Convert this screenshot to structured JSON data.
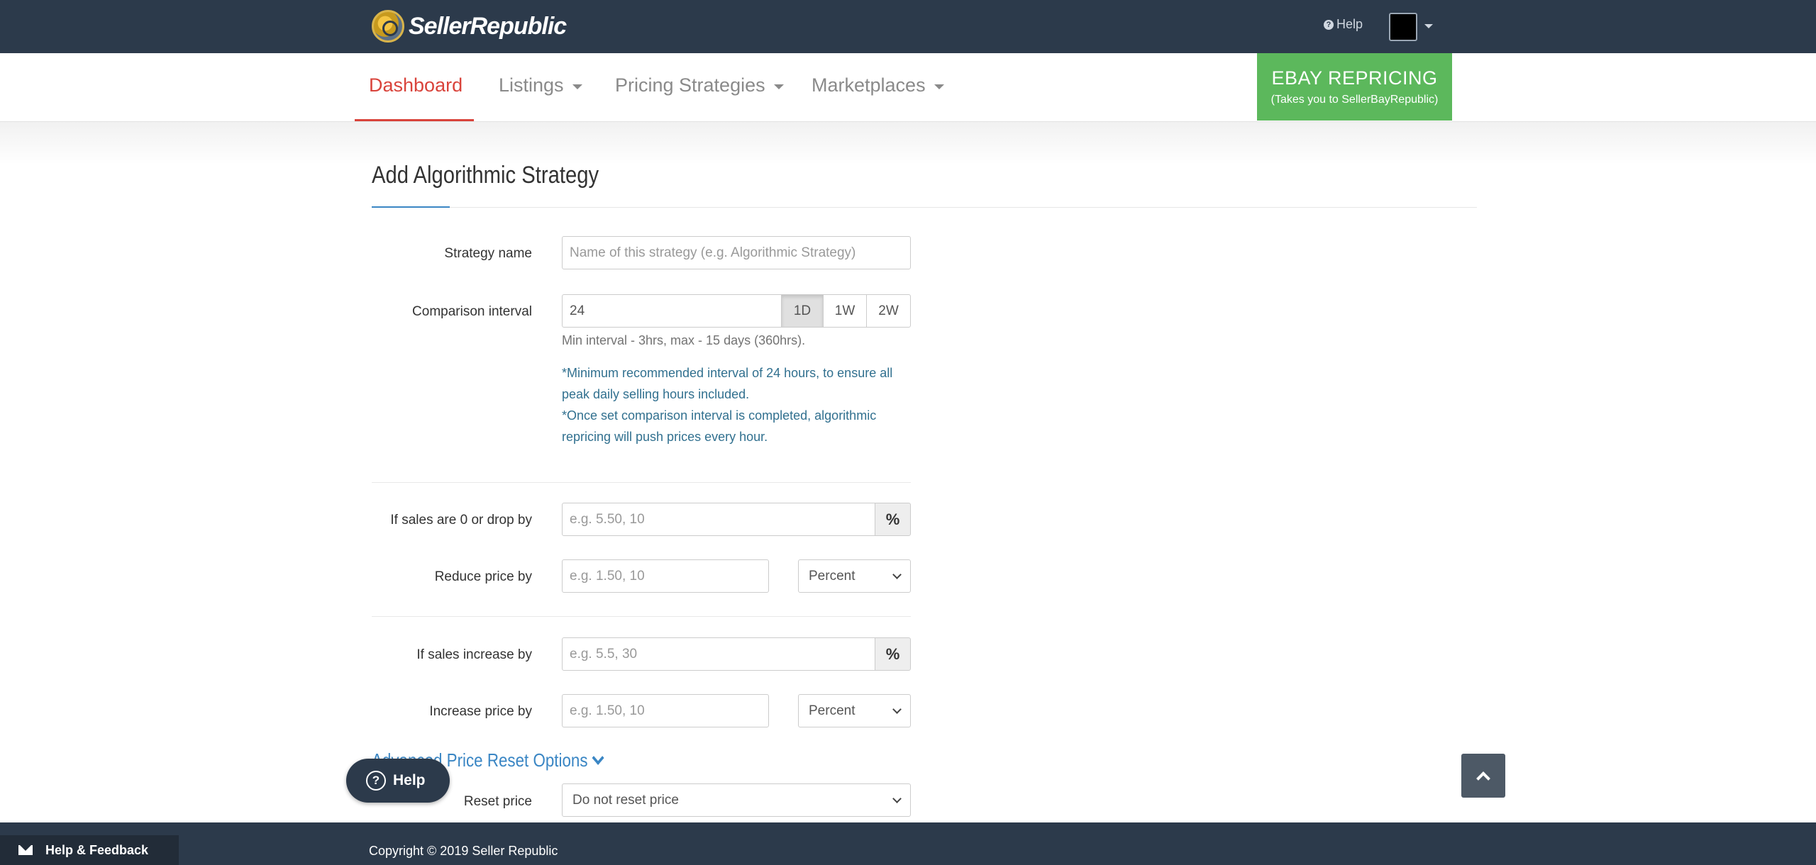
{
  "brand": {
    "name": "SellerRepublic"
  },
  "topbar": {
    "help_label": "Help"
  },
  "nav": {
    "items": [
      {
        "label": "Dashboard"
      },
      {
        "label": "Listings"
      },
      {
        "label": "Pricing Strategies"
      },
      {
        "label": "Marketplaces"
      }
    ],
    "ebay_button": {
      "title": "EBAY REPRICING",
      "subtitle": "(Takes you to SellerBayRepublic)"
    }
  },
  "page": {
    "title": "Add Algorithmic Strategy"
  },
  "form": {
    "strategy_name": {
      "label": "Strategy name",
      "placeholder": "Name of this strategy (e.g. Algorithmic Strategy)"
    },
    "comparison_interval": {
      "label": "Comparison interval",
      "value": "24",
      "options": [
        "1D",
        "1W",
        "2W"
      ],
      "selected": "1D",
      "help": "Min interval - 3hrs, max - 15 days (360hrs).",
      "notes": [
        "*Minimum recommended interval of 24 hours, to ensure all peak daily selling hours included.",
        "*Once set comparison interval is completed, algorithmic repricing will push prices every hour."
      ]
    },
    "sales_drop": {
      "label": "If sales are 0 or drop by",
      "placeholder": "e.g. 5.50, 10",
      "addon": "%"
    },
    "reduce_price": {
      "label": "Reduce price by",
      "placeholder": "e.g. 1.50, 10",
      "unit": "Percent"
    },
    "sales_increase": {
      "label": "If sales increase by",
      "placeholder": "e.g. 5.5, 30",
      "addon": "%"
    },
    "increase_price": {
      "label": "Increase price by",
      "placeholder": "e.g. 1.50, 10",
      "unit": "Percent"
    },
    "advanced_link": "Advanced Price Reset Options",
    "reset_price": {
      "label": "Reset price",
      "value": "Do not reset price"
    }
  },
  "floating": {
    "help_label": "Help",
    "feedback_label": "Help & Feedback"
  },
  "footer": {
    "copyright": "Copyright © 2019 Seller Republic"
  }
}
